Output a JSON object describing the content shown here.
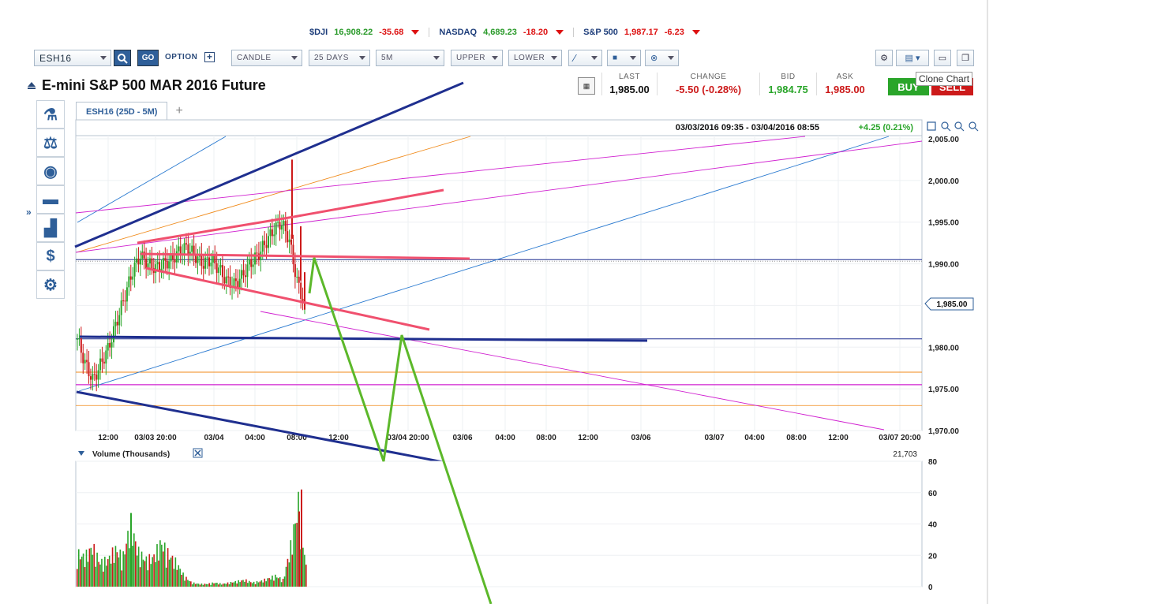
{
  "tickers": [
    {
      "name": "$DJI",
      "price": "16,908.22",
      "change": "-35.68"
    },
    {
      "name": "NASDAQ",
      "price": "4,689.23",
      "change": "-18.20"
    },
    {
      "name": "S&P 500",
      "price": "1,987.17",
      "change": "-6.23"
    }
  ],
  "toolbar": {
    "symbol": "ESH16",
    "go_label": "GO",
    "option_label": "OPTION",
    "chart_type": "CANDLE",
    "period": "25 DAYS",
    "interval": "5M",
    "upper": "UPPER",
    "lower": "LOWER"
  },
  "header": {
    "title": "E-mini S&P 500 MAR 2016 Future",
    "last_label": "LAST",
    "last": "1,985.00",
    "change_label": "CHANGE",
    "change": "-5.50 (-0.28%)",
    "bid_label": "BID",
    "bid": "1,984.75",
    "ask_label": "ASK",
    "ask": "1,985.00",
    "buy": "BUY",
    "sell": "SELL",
    "tooltip": "Clone Chart"
  },
  "tabs": [
    {
      "label": "ESH16 (25D - 5M)"
    }
  ],
  "chart": {
    "range_text": "03/03/2016 09:35 - 03/04/2016 08:55",
    "range_change": "+4.25 (0.21%)",
    "current_price_label": "1,985.00",
    "volume_title": "Volume (Thousands)",
    "volume_last": "21,703",
    "colors": {
      "up": "#2aa52a",
      "down": "#cc1a1a",
      "navy": "#1f2f8f",
      "pink": "#f0506e",
      "green": "#5cb82a",
      "magenta": "#d020d0",
      "orange": "#f08a1a",
      "blue": "#2a7ad0"
    }
  },
  "chart_data": [
    {
      "type": "candlestick",
      "title": "",
      "y_ticks": [
        "2,005.00",
        "2,000.00",
        "1,995.00",
        "1,990.00",
        "1,985.00",
        "1,980.00",
        "1,975.00",
        "1,970.00"
      ],
      "ylim": [
        1970,
        2005
      ],
      "x_ticks": [
        "12:00",
        "03/03 20:00",
        "03/04",
        "04:00",
        "08:00",
        "12:00",
        "03/04 20:00",
        "03/06",
        "04:00",
        "08:00",
        "12:00",
        "03/06",
        "03/07",
        "04:00",
        "08:00",
        "12:00",
        "03/07 20:00"
      ],
      "close": [
        1981,
        1978,
        1976,
        1978,
        1980,
        1983,
        1986,
        1989,
        1991,
        1990,
        1989.5,
        1990,
        1990.5,
        1991.5,
        1992,
        1991,
        1990,
        1990.5,
        1989.5,
        1988,
        1987.5,
        1988.5,
        1990,
        1991,
        1992.5,
        1994,
        1995,
        1993,
        1988,
        1985
      ]
    },
    {
      "type": "bar",
      "title": "Volume (Thousands)",
      "y_ticks": [
        "80",
        "60",
        "40",
        "20",
        "0"
      ],
      "ylim": [
        0,
        80
      ],
      "values": [
        25,
        22,
        30,
        18,
        20,
        28,
        22,
        47,
        26,
        20,
        22,
        33,
        24,
        18,
        8,
        3,
        2,
        2,
        3,
        2,
        3,
        4,
        5,
        3,
        4,
        6,
        8,
        5,
        30,
        62,
        15
      ]
    }
  ]
}
